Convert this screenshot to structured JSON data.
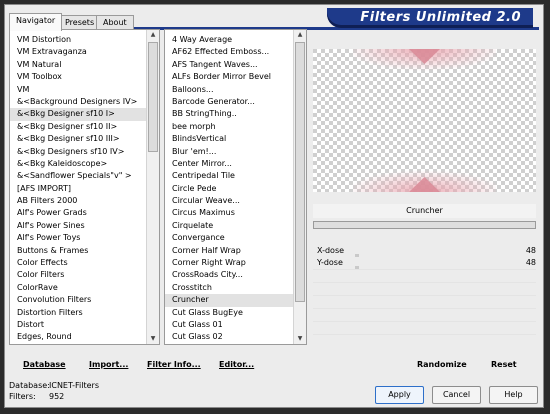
{
  "window": {
    "title": "Filters Unlimited 2.0"
  },
  "tabs": [
    {
      "label": "Navigator",
      "active": true
    },
    {
      "label": "Presets",
      "active": false
    },
    {
      "label": "About",
      "active": false
    }
  ],
  "categories": [
    {
      "label": "VM Distortion"
    },
    {
      "label": "VM Extravaganza"
    },
    {
      "label": "VM Natural"
    },
    {
      "label": "VM Toolbox"
    },
    {
      "label": "VM"
    },
    {
      "label": "&<Background Designers IV>"
    },
    {
      "label": "&<Bkg Designer sf10 I>",
      "selected": true
    },
    {
      "label": "&<Bkg Designer sf10 II>"
    },
    {
      "label": "&<Bkg Designer sf10 III>"
    },
    {
      "label": "&<Bkg Designers sf10 IV>"
    },
    {
      "label": "&<Bkg Kaleidoscope>"
    },
    {
      "label": "&<Sandflower Specials\"v\" >"
    },
    {
      "label": "[AFS IMPORT]"
    },
    {
      "label": "AB Filters 2000"
    },
    {
      "label": "Alf's Power Grads"
    },
    {
      "label": "Alf's Power Sines"
    },
    {
      "label": "Alf's Power Toys"
    },
    {
      "label": "Buttons & Frames"
    },
    {
      "label": "Color Effects"
    },
    {
      "label": "Color Filters"
    },
    {
      "label": "ColorRave"
    },
    {
      "label": "Convolution Filters"
    },
    {
      "label": "Distortion Filters"
    },
    {
      "label": "Distort"
    },
    {
      "label": "Edges, Round"
    }
  ],
  "filters": [
    {
      "label": "4 Way Average"
    },
    {
      "label": "AF62 Effected Emboss..."
    },
    {
      "label": "AFS Tangent Waves..."
    },
    {
      "label": "ALFs Border Mirror Bevel"
    },
    {
      "label": "Balloons..."
    },
    {
      "label": "Barcode Generator..."
    },
    {
      "label": "BB StringThing.."
    },
    {
      "label": "bee morph"
    },
    {
      "label": "BlindsVertical"
    },
    {
      "label": "Blur 'em!..."
    },
    {
      "label": "Center Mirror..."
    },
    {
      "label": "Centripedal Tile"
    },
    {
      "label": "Circle Pede"
    },
    {
      "label": "Circular Weave..."
    },
    {
      "label": "Circus Maximus"
    },
    {
      "label": "Cirquelate"
    },
    {
      "label": "Convergance"
    },
    {
      "label": "Corner Half Wrap"
    },
    {
      "label": "Corner Right Wrap"
    },
    {
      "label": "CrossRoads City..."
    },
    {
      "label": "Crosstitch"
    },
    {
      "label": "Cruncher",
      "selected": true
    },
    {
      "label": "Cut Glass  BugEye"
    },
    {
      "label": "Cut Glass 01"
    },
    {
      "label": "Cut Glass 02"
    }
  ],
  "selected_filter": "Cruncher",
  "params": [
    {
      "label": "X-dose",
      "value": "48"
    },
    {
      "label": "Y-dose",
      "value": "48"
    }
  ],
  "links": {
    "database": "Database",
    "import": "Import...",
    "filter_info": "Filter Info...",
    "editor": "Editor...",
    "randomize": "Randomize",
    "reset": "Reset"
  },
  "status": {
    "database_label": "Database:",
    "database_value": "ICNET-Filters",
    "filters_label": "Filters:",
    "filters_value": "952"
  },
  "buttons": {
    "apply": "Apply",
    "cancel": "Cancel",
    "help": "Help"
  },
  "colors": {
    "banner": "#1e3a8a",
    "preview_pink": "#e9a6b0",
    "selection": "#e2e2e2"
  }
}
